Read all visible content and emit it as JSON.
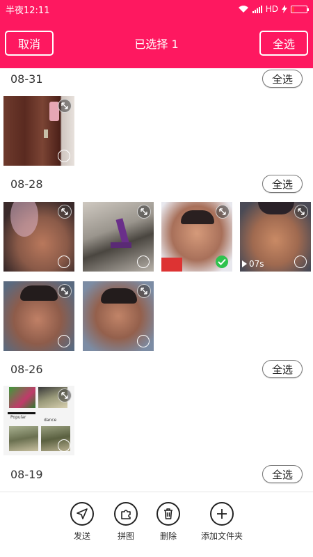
{
  "status_bar": {
    "time": "半夜12:11",
    "network": "HD"
  },
  "header": {
    "cancel_label": "取消",
    "title": "已选择 1",
    "select_all_label": "全选"
  },
  "sections": [
    {
      "date": "08-31",
      "select_all_label": "全选"
    },
    {
      "date": "08-28",
      "select_all_label": "全选"
    },
    {
      "date": "08-26",
      "select_all_label": "全选"
    },
    {
      "date": "08-19",
      "select_all_label": "全选"
    }
  ],
  "video_duration": "07s",
  "collage_captions": [
    "Popular",
    "dance"
  ],
  "bottom_actions": [
    {
      "label": "发送",
      "icon": "send-icon"
    },
    {
      "label": "拼图",
      "icon": "puzzle-icon"
    },
    {
      "label": "删除",
      "icon": "trash-icon"
    },
    {
      "label": "添加文件夹",
      "icon": "add-folder-icon"
    }
  ],
  "colors": {
    "brand": "#fe1860",
    "checked": "#2fc24e"
  }
}
